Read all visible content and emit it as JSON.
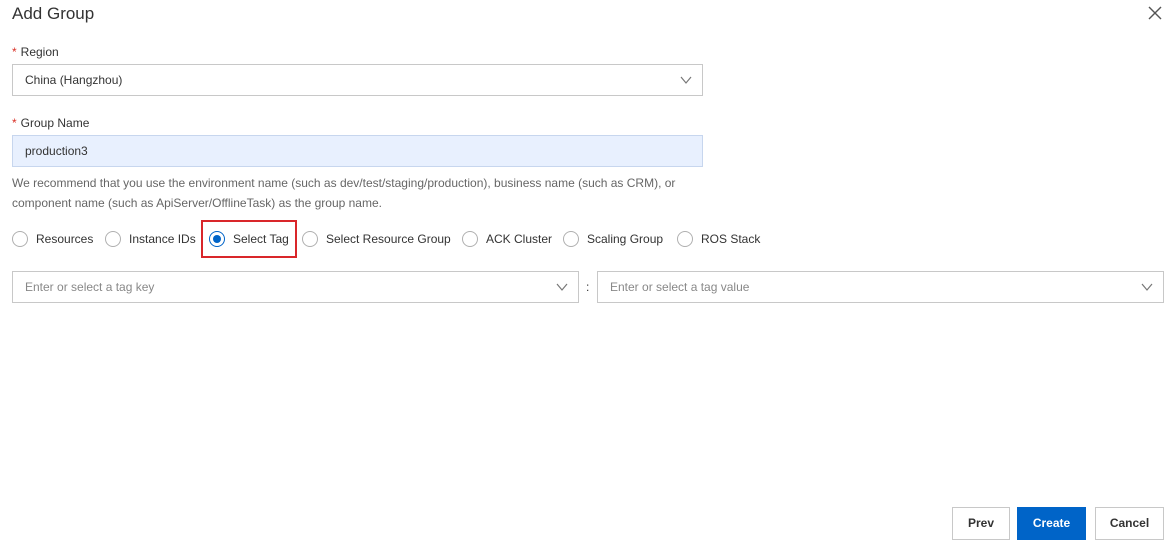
{
  "dialog": {
    "title": "Add Group",
    "close_icon": "close-icon"
  },
  "region": {
    "required_mark": "*",
    "label": "Region",
    "value": "China (Hangzhou)"
  },
  "group_name": {
    "required_mark": "*",
    "label": "Group Name",
    "value": "production3",
    "hint_line1": "We recommend that you use the environment name (such as dev/test/staging/production), business name (such as CRM), or",
    "hint_line2": "component name (such as ApiServer/OfflineTask) as the group name."
  },
  "source_options": [
    {
      "label": "Resources",
      "checked": false
    },
    {
      "label": "Instance IDs",
      "checked": false
    },
    {
      "label": "Select Tag",
      "checked": true
    },
    {
      "label": "Select Resource Group",
      "checked": false
    },
    {
      "label": "ACK Cluster",
      "checked": false
    },
    {
      "label": "Scaling Group",
      "checked": false
    },
    {
      "label": "ROS Stack",
      "checked": false
    }
  ],
  "tag": {
    "key_placeholder": "Enter or select a tag key",
    "separator": ":",
    "value_placeholder": "Enter or select a tag value"
  },
  "footer": {
    "prev_label": "Prev",
    "create_label": "Create",
    "cancel_label": "Cancel"
  },
  "colors": {
    "primary": "#0064c8",
    "required": "#d93026",
    "highlight": "#d9262a",
    "filled_input_bg": "#e8f0fe"
  }
}
